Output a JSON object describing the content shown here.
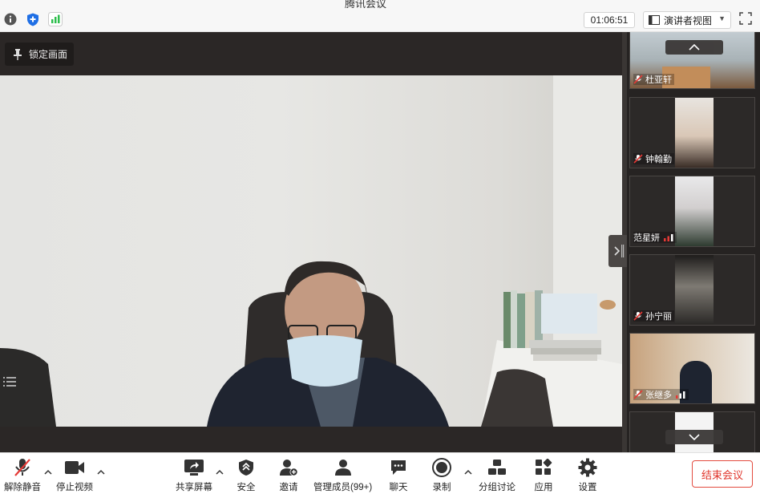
{
  "window": {
    "title": "腾讯会议"
  },
  "topbar": {
    "timer": "01:06:51",
    "view_label": "演讲者视图",
    "colors": {
      "shield": "#1f6fe5",
      "signal": "#2dbe4d"
    }
  },
  "main": {
    "lock_label": "锁定画面"
  },
  "participants": [
    {
      "name": "杜亚轩",
      "mic": "muted"
    },
    {
      "name": "钟翰勤",
      "mic": "muted"
    },
    {
      "name": "范星妍",
      "mic": "on"
    },
    {
      "name": "孙宁丽",
      "mic": "muted"
    },
    {
      "name": "张继多",
      "mic": "muted"
    },
    {
      "name": "",
      "mic": ""
    }
  ],
  "toolbar": {
    "unmute": "解除静音",
    "stop_video": "停止视频",
    "share_screen": "共享屏幕",
    "security": "安全",
    "invite": "邀请",
    "manage_members": "管理成员(99+)",
    "chat": "聊天",
    "record": "录制",
    "breakout": "分组讨论",
    "apps": "应用",
    "settings": "设置",
    "end_meeting": "结束会议",
    "end_color": "#e0352b"
  }
}
